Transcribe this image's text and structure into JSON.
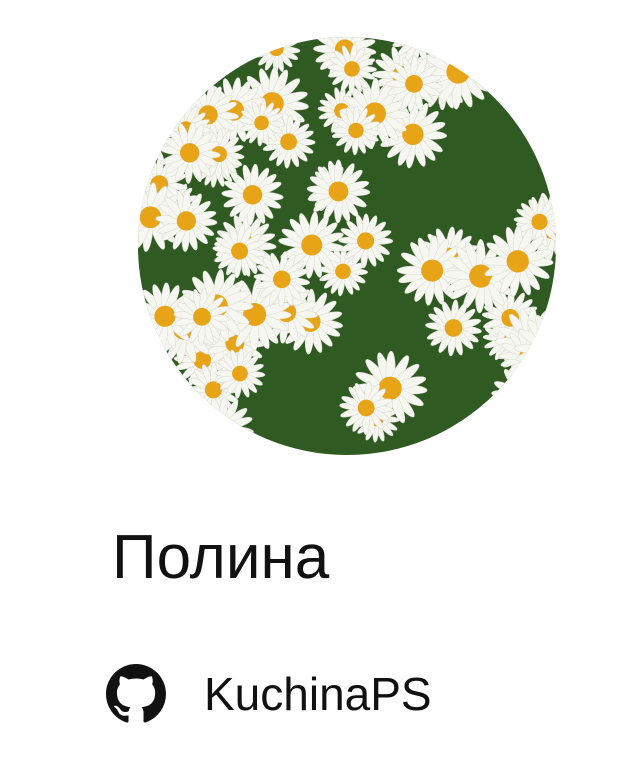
{
  "profile": {
    "name": "Полина",
    "avatar_icon": "daisies-photo",
    "github": {
      "icon": "github-icon",
      "username": "KuchinaPS"
    }
  },
  "colors": {
    "petal": "#ffffff",
    "center": "#e8a417",
    "leaves": "#2f5a22"
  }
}
